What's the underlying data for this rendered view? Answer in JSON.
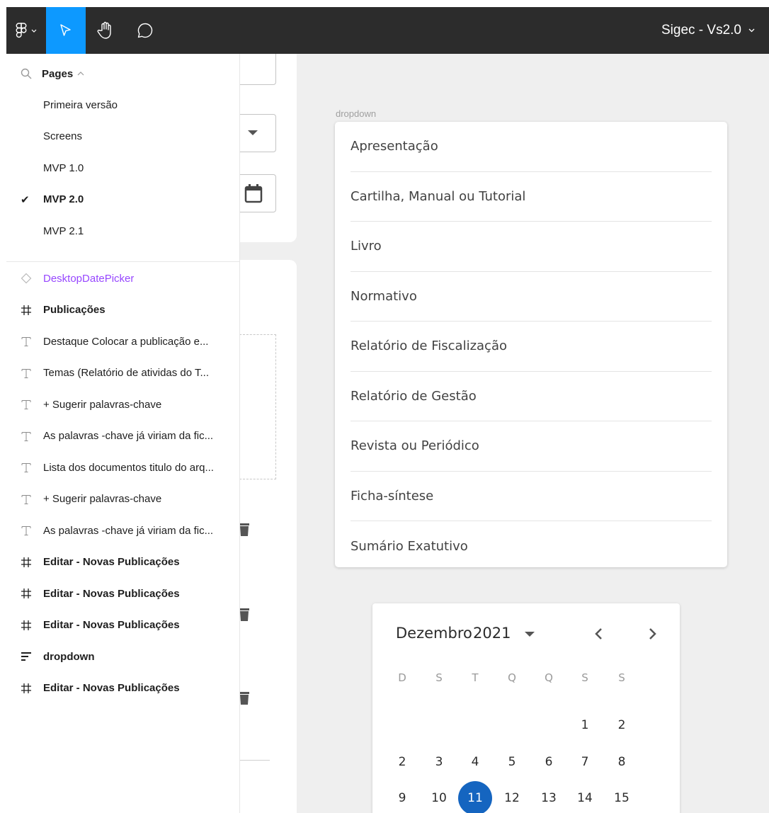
{
  "toolbar": {
    "tools": [
      {
        "name": "main-menu",
        "icon": "figma-logo-icon"
      },
      {
        "name": "move-tool",
        "icon": "cursor-icon",
        "active": true
      },
      {
        "name": "hand-tool",
        "icon": "hand-icon"
      },
      {
        "name": "comment-tool",
        "icon": "comment-icon"
      }
    ],
    "file_title": "Sigec - Vs2.0",
    "accent_color": "#0d99ff"
  },
  "pages": {
    "header": "Pages",
    "items": [
      {
        "label": "Primeira versão",
        "current": false
      },
      {
        "label": "Screens",
        "current": false
      },
      {
        "label": "MVP 1.0",
        "current": false
      },
      {
        "label": "MVP 2.0",
        "current": true
      },
      {
        "label": "MVP 2.1",
        "current": false
      }
    ],
    "check_glyph": "✔"
  },
  "layers": [
    {
      "label": "DesktopDatePicker",
      "type": "component"
    },
    {
      "label": "Publicações",
      "type": "frame"
    },
    {
      "label": "Destaque Colocar a publicação e...",
      "type": "text"
    },
    {
      "label": "Temas (Relatório de atividas do T...",
      "type": "text"
    },
    {
      "label": "+ Sugerir palavras-chave",
      "type": "text"
    },
    {
      "label": "As palavras -chave já viriam da fic...",
      "type": "text"
    },
    {
      "label": "Lista dos documentos titulo do arq...",
      "type": "text"
    },
    {
      "label": "+ Sugerir palavras-chave",
      "type": "text"
    },
    {
      "label": "As palavras -chave já viriam da fic...",
      "type": "text"
    },
    {
      "label": "Editar - Novas Publicações",
      "type": "frame"
    },
    {
      "label": "Editar - Novas Publicações",
      "type": "frame"
    },
    {
      "label": "Editar - Novas Publicações",
      "type": "frame"
    },
    {
      "label": "dropdown",
      "type": "autolayout"
    },
    {
      "label": "Editar - Novas Publicações",
      "type": "frame"
    }
  ],
  "layer_colors": {
    "component": "#9747ff"
  },
  "dropdown": {
    "frame_label": "dropdown",
    "items": [
      "Apresentação",
      "Cartilha, Manual ou Tutorial",
      "Livro",
      "Normativo",
      "Relatório de Fiscalização",
      "Relatório de Gestão",
      "Revista ou Periódico",
      "Ficha-síntese",
      "Sumário Exatutivo"
    ]
  },
  "calendar": {
    "month": "Dezembro",
    "year": "2021",
    "weekdays": [
      "D",
      "S",
      "T",
      "Q",
      "Q",
      "S",
      "S"
    ],
    "weeks": [
      [
        "",
        "",
        "",
        "",
        "",
        "1",
        "2"
      ],
      [
        "2",
        "3",
        "4",
        "5",
        "6",
        "7",
        "8"
      ],
      [
        "9",
        "10",
        "11",
        "12",
        "13",
        "14",
        "15"
      ]
    ],
    "selected_day": "11",
    "selected_color": "#1565c0"
  }
}
